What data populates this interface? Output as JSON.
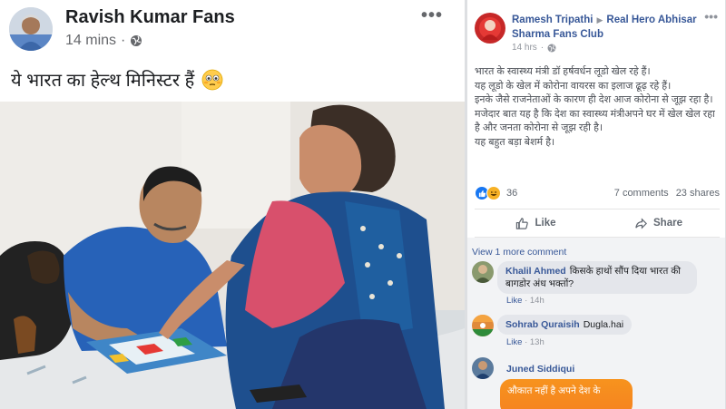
{
  "left_post": {
    "page_name": "Ravish Kumar Fans",
    "time": "14 mins",
    "dot": "·",
    "more": "•••",
    "caption": "ये भारत का हेल्थ मिनिस्टर हैं",
    "caption_emoji": "flushed-face-emoji"
  },
  "right_post": {
    "author": "Ramesh Tripathi",
    "separator": "▶",
    "group": "Real Hero Abhisar Sharma Fans Club",
    "time": "14 hrs",
    "dot": "·",
    "more": "•••",
    "body_lines": [
      "भारत के स्वास्थ्य मंत्री डॉ हर्षवर्धन लूडो खेल रहे हैं।",
      "यह लूडो के खेल में कोरोना वायरस का इलाज ढूढ़ रहे हैं।",
      "इनके जैसे राजनेताओं के कारण ही देश आज कोरोना से जूझ रहा है।",
      "मजेदार बात यह है कि देश का स्वास्थ्य मंत्रीअपने घर में खेल खेल रहा है और जनता कोरोना से जूझ रही है।",
      "यह बहुत बड़ा बेशर्म है।"
    ],
    "reaction_count": "36",
    "comments_count": "7 comments",
    "shares_count": "23 shares",
    "like_label": "Like",
    "share_label": "Share",
    "view_more_comments": "View 1 more comment",
    "comments": [
      {
        "author": "Khalil Ahmed",
        "text": "किसके हाथों सौंप दिया भारत की बागडोर अंध भक्तों?",
        "like": "Like",
        "time": "14h"
      },
      {
        "author": "Sohrab Quraisih",
        "text": "Dugla.hai",
        "like": "Like",
        "time": "13h"
      },
      {
        "author": "Juned Siddiqui",
        "text": "औकात नहीं है अपने देश के"
      }
    ]
  },
  "colors": {
    "fb_blue": "#385898",
    "like_blue": "#1877f2",
    "haha_yellow": "#f7b125",
    "comment_bg": "#f2f3f5",
    "orange_bubble": "#f58220"
  }
}
